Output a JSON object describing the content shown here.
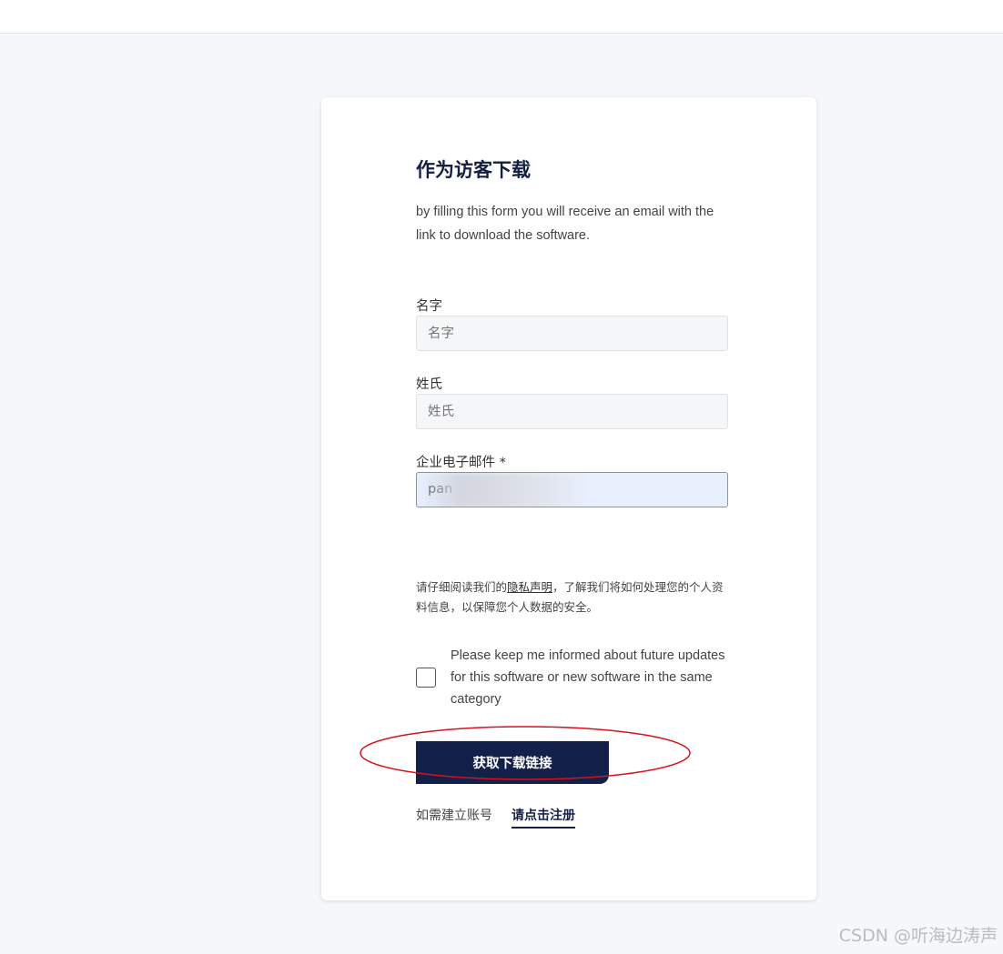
{
  "form": {
    "title": "作为访客下载",
    "description": "by filling this form you will receive an email with the link to download the software.",
    "first_name": {
      "label": "名字",
      "placeholder": "名字"
    },
    "last_name": {
      "label": "姓氏",
      "placeholder": "姓氏"
    },
    "email": {
      "label": "企业电子邮件 *",
      "value": "pan"
    },
    "privacy": {
      "before": "请仔细阅读我们的",
      "link": "隐私声明",
      "after": "，了解我们将如何处理您的个人资料信息，以保障您个人数据的安全。"
    },
    "newsletter_checkbox": {
      "label": "Please keep me informed about future updates for this software or new software in the same category",
      "checked": false
    },
    "submit_label": "获取下载链接",
    "register_prompt": "如需建立账号",
    "register_link": "请点击注册"
  },
  "watermark": "CSDN @听海边涛声",
  "colors": {
    "primary": "#13204a",
    "page_bg": "#f6f7f9",
    "annotation": "#d6121a"
  }
}
